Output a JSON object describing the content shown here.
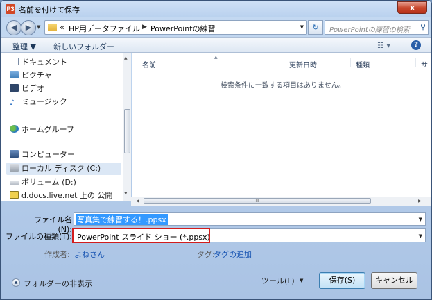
{
  "window": {
    "title": "名前を付けて保存",
    "app_icon_text": "P3",
    "close_glyph": "x"
  },
  "nav": {
    "back_glyph": "◀",
    "forward_glyph": "▶",
    "breadcrumb_overflow": "«",
    "breadcrumb": [
      "HP用データファイル",
      "PowerPointの練習"
    ],
    "search_placeholder": "PowerPointの練習の検索"
  },
  "toolbar": {
    "organize": "整理 ▼",
    "new_folder": "新しいフォルダー"
  },
  "navpane": {
    "items": [
      {
        "label": "ドキュメント",
        "icon": "document-icon"
      },
      {
        "label": "ピクチャ",
        "icon": "pictures-icon"
      },
      {
        "label": "ビデオ",
        "icon": "video-icon"
      },
      {
        "label": "ミュージック",
        "icon": "music-icon"
      },
      {
        "label": "ホームグループ",
        "icon": "homegroup-icon"
      },
      {
        "label": "コンピューター",
        "icon": "computer-icon"
      },
      {
        "label": "ローカル ディスク (C:)",
        "icon": "local-disk-icon",
        "selected": true
      },
      {
        "label": "ボリューム (D:)",
        "icon": "volume-icon"
      },
      {
        "label": "d.docs.live.net 上の 公開",
        "icon": "network-folder-icon"
      }
    ]
  },
  "filelist": {
    "columns": [
      "名前",
      "更新日時",
      "種類",
      "サ"
    ],
    "empty_message": "検索条件に一致する項目はありません。"
  },
  "form": {
    "filename_label": "ファイル名(N):",
    "filename_value": "写真集で練習する！.ppsx",
    "filetype_label": "ファイルの種類(T):",
    "filetype_value": "PowerPoint スライド ショー (*.ppsx)",
    "author_label": "作成者:",
    "author_value": "よねさん",
    "tags_label": "タグ:",
    "tags_value": "タグの追加"
  },
  "footer": {
    "hide_folders": "フォルダーの非表示",
    "tools": "ツール(L)",
    "save": "保存(S)",
    "cancel": "キャンセル"
  },
  "colors": {
    "highlight_box": "#d21d1d",
    "selection": "#3399ff",
    "link": "#1a56b3"
  }
}
